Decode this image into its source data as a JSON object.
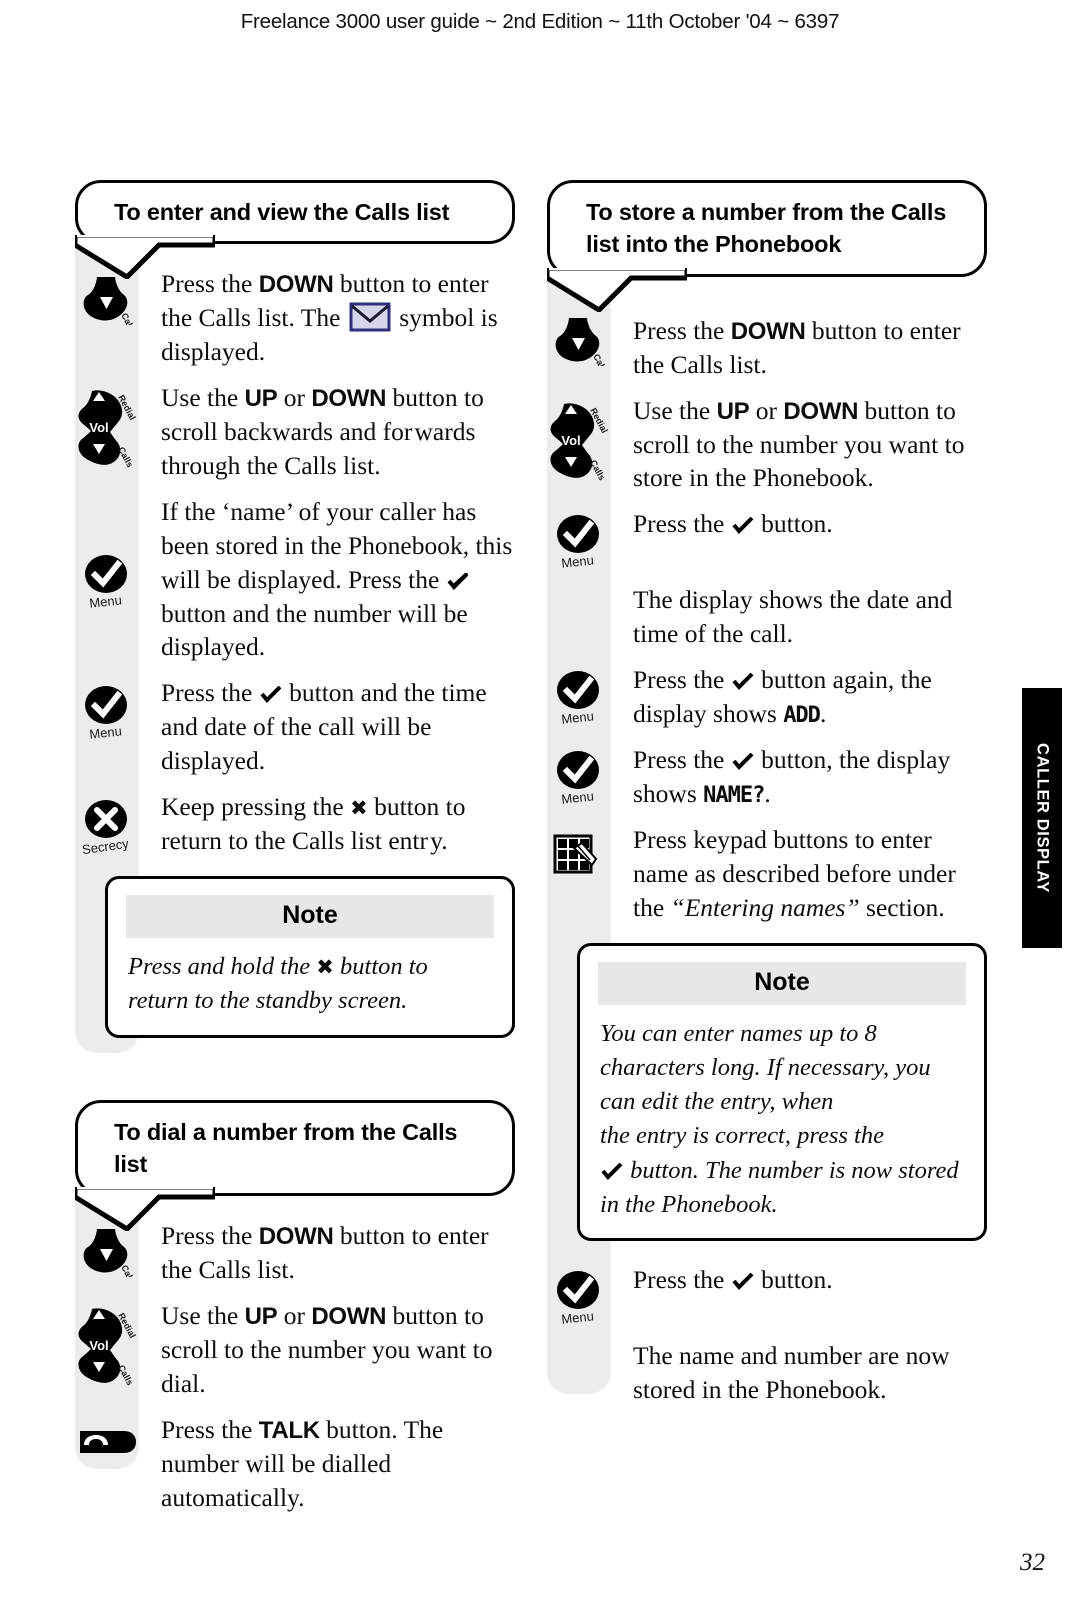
{
  "header": {
    "title": "Freelance 3000 user guide ~ 2nd Edition ~ 11th October '04 ~ 6397"
  },
  "side_tab": {
    "label": "CALLER DISPLAY"
  },
  "page_number": "32",
  "colors": {
    "grey_strip": "#ececec",
    "note_header": "#e7e7e7",
    "side_tab_bg": "#000000",
    "envelope_fill": "#d6d6ea",
    "envelope_stroke": "#2e2e7a"
  },
  "icon_labels": {
    "calls": "Calls",
    "redial": "Redial",
    "vol": "Vol",
    "menu": "Menu",
    "secrecy": "Secrecy"
  },
  "left_column": {
    "section1": {
      "heading": "To enter and view the Calls list",
      "steps": [
        {
          "icon": "down-button-icon",
          "text_parts": [
            {
              "t": "Press the ",
              "style": "normal"
            },
            {
              "t": "DOWN",
              "style": "key"
            },
            {
              "t": " button to enter the Calls list. The ",
              "style": "normal"
            },
            {
              "t": "envelope-symbol",
              "style": "envelope"
            },
            {
              "t": " symbol is displayed.",
              "style": "normal"
            }
          ]
        },
        {
          "icon": "vol-rocker-icon",
          "text_parts": [
            {
              "t": "Use the ",
              "style": "normal"
            },
            {
              "t": "UP",
              "style": "key"
            },
            {
              "t": " or ",
              "style": "normal"
            },
            {
              "t": "DOWN",
              "style": "key"
            },
            {
              "t": " button to scroll backwards and for wards through the Calls list.",
              "style": "normal"
            }
          ]
        },
        {
          "icon": "menu-check-icon",
          "text_parts": [
            {
              "t": "If the ‘name’ of your caller has been stored in the Phonebook, this will be displayed. Press the ",
              "style": "normal"
            },
            {
              "t": "check-glyph",
              "style": "check"
            },
            {
              "t": " button and the number will be displayed.",
              "style": "normal"
            }
          ]
        },
        {
          "icon": "menu-check-icon",
          "text_parts": [
            {
              "t": "Press the ",
              "style": "normal"
            },
            {
              "t": "check-glyph",
              "style": "check"
            },
            {
              "t": " button and the time and date of the call will be displayed.",
              "style": "normal"
            }
          ]
        },
        {
          "icon": "secrecy-x-icon",
          "text_parts": [
            {
              "t": "Keep pressing the ",
              "style": "normal"
            },
            {
              "t": "✖",
              "style": "xmark"
            },
            {
              "t": " button to return to the Calls list entr y.",
              "style": "normal"
            }
          ]
        }
      ],
      "note": {
        "title": "Note",
        "parts": [
          {
            "t": "Press and hold the ",
            "style": "normal"
          },
          {
            "t": "✖",
            "style": "xmark"
          },
          {
            "t": " button to return to the standby screen.",
            "style": "normal"
          }
        ]
      }
    },
    "section2": {
      "heading": "To dial a number from the Calls list",
      "steps": [
        {
          "icon": "down-button-icon",
          "text_parts": [
            {
              "t": "Press the ",
              "style": "normal"
            },
            {
              "t": "DOWN",
              "style": "key"
            },
            {
              "t": " button to enter the Calls list.",
              "style": "normal"
            }
          ]
        },
        {
          "icon": "vol-rocker-icon",
          "text_parts": [
            {
              "t": "Use the ",
              "style": "normal"
            },
            {
              "t": "UP",
              "style": "key"
            },
            {
              "t": " or ",
              "style": "normal"
            },
            {
              "t": "DOWN",
              "style": "key"
            },
            {
              "t": " button to scroll to the number you want to dial.",
              "style": "normal"
            }
          ]
        },
        {
          "icon": "talk-button-icon",
          "text_parts": [
            {
              "t": "Press the ",
              "style": "normal"
            },
            {
              "t": "TALK",
              "style": "key"
            },
            {
              "t": " button. The number will be dialled automatically.",
              "style": "normal"
            }
          ]
        }
      ]
    }
  },
  "right_column": {
    "section1": {
      "heading": "To store a number from the Calls list into the Phonebook",
      "steps": [
        {
          "icon": "down-button-icon",
          "text_parts": [
            {
              "t": "Press the ",
              "style": "normal"
            },
            {
              "t": "DOWN",
              "style": "key"
            },
            {
              "t": " button to enter the Calls list.",
              "style": "normal"
            }
          ]
        },
        {
          "icon": "vol-rocker-icon",
          "text_parts": [
            {
              "t": "Use the ",
              "style": "normal"
            },
            {
              "t": "UP",
              "style": "key"
            },
            {
              "t": " or ",
              "style": "normal"
            },
            {
              "t": "DOWN",
              "style": "key"
            },
            {
              "t": " button to scroll to the number you want to store in the Phonebook.",
              "style": "normal"
            }
          ]
        },
        {
          "icon": "menu-check-icon",
          "text_parts": [
            {
              "t": "Press the ",
              "style": "normal"
            },
            {
              "t": "check-glyph",
              "style": "check"
            },
            {
              "t": " button.",
              "style": "normal"
            }
          ]
        },
        {
          "icon": "none",
          "text_parts": [
            {
              "t": "The display shows the date and time of the call.",
              "style": "normal"
            }
          ]
        },
        {
          "icon": "menu-check-icon",
          "text_parts": [
            {
              "t": "Press the ",
              "style": "normal"
            },
            {
              "t": "check-glyph",
              "style": "check"
            },
            {
              "t": " button again, the display shows ",
              "style": "normal"
            },
            {
              "t": "ADD",
              "style": "lcd"
            },
            {
              "t": ".",
              "style": "normal"
            }
          ]
        },
        {
          "icon": "menu-check-icon",
          "text_parts": [
            {
              "t": "Press the ",
              "style": "normal"
            },
            {
              "t": "check-glyph",
              "style": "check"
            },
            {
              "t": " button, the display shows ",
              "style": "normal"
            },
            {
              "t": "NAME?",
              "style": "lcd"
            },
            {
              "t": ".",
              "style": "normal"
            }
          ]
        },
        {
          "icon": "keypad-icon",
          "text_parts": [
            {
              "t": "Press keypad buttons to enter name as described before under the ",
              "style": "normal"
            },
            {
              "t": "“Entering names”",
              "style": "italic"
            },
            {
              "t": " section.",
              "style": "normal"
            }
          ]
        }
      ],
      "note": {
        "title": "Note",
        "parts": [
          {
            "t": "You can enter names up to 8 characters long. If necessary, you can edit the entry, when the entry is correct, press the ",
            "style": "normal"
          },
          {
            "t": "check-glyph",
            "style": "check"
          },
          {
            "t": " button. The number is now stored in the Phonebook.",
            "style": "normal"
          }
        ]
      },
      "steps_after_note": [
        {
          "icon": "menu-check-icon",
          "text_parts": [
            {
              "t": "Press the ",
              "style": "normal"
            },
            {
              "t": "check-glyph",
              "style": "check"
            },
            {
              "t": " button.",
              "style": "normal"
            }
          ]
        },
        {
          "icon": "none",
          "text_parts": [
            {
              "t": "The name and number are now stored in the Phonebook.",
              "style": "normal"
            }
          ]
        }
      ]
    }
  }
}
